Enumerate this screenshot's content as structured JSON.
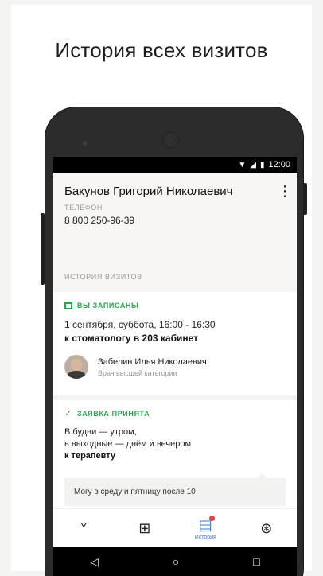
{
  "headline": "История всех визитов",
  "status_bar": {
    "time": "12:00"
  },
  "patient": {
    "name": "Бакунов Григорий Николаевич",
    "phone_label": "ТЕЛЕФОН",
    "phone": "8 800 250-96-39"
  },
  "history": {
    "section_title": "ИСТОРИЯ ВИЗИТОВ",
    "appointment": {
      "status": "ВЫ ЗАПИСАНЫ",
      "date": "1 сентября, суббота, 16:00 - 16:30",
      "where": "к стоматологу в 203 кабинет",
      "doctor_name": "Забелин Илья Николаевич",
      "doctor_title": "Врач высшей категории"
    },
    "request": {
      "status": "ЗАЯВКА ПРИНЯТА",
      "line1": "В будни — утром,",
      "line2": "в выходные — днём и вечером",
      "line3": "к терапевту",
      "note": "Могу в среду и пятницу после 10"
    }
  },
  "tabs": [
    {
      "icon": "stethoscope-icon",
      "label": ""
    },
    {
      "icon": "map-book-icon",
      "label": ""
    },
    {
      "icon": "history-icon",
      "label": "История"
    },
    {
      "icon": "lifebuoy-icon",
      "label": ""
    }
  ],
  "colors": {
    "accent": "#3a7bd5",
    "success": "#25a84d",
    "badge": "#e0413a"
  }
}
